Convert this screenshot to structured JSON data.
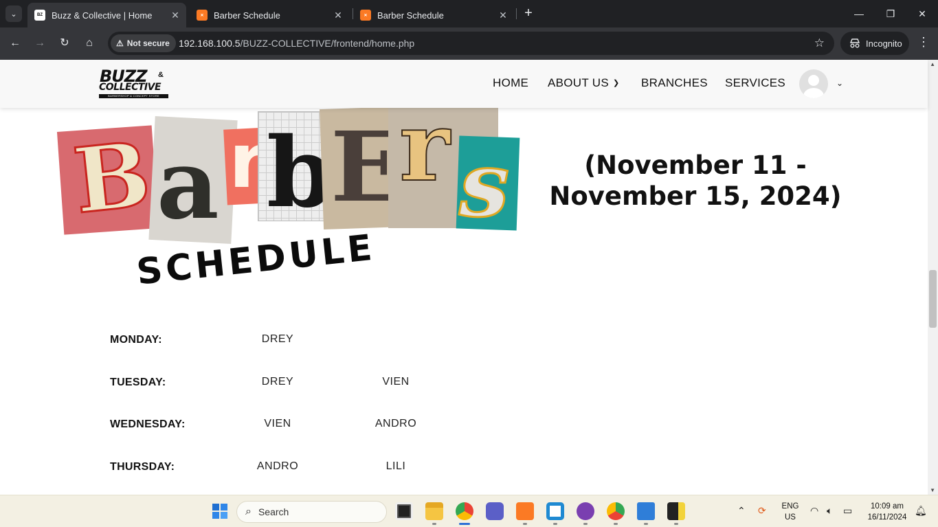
{
  "browser": {
    "tabs": [
      {
        "title": "Buzz & Collective | Home",
        "favicon": "buzz-favicon",
        "active": true
      },
      {
        "title": "Barber Schedule",
        "favicon": "xampp-favicon",
        "active": false
      },
      {
        "title": "Barber Schedule",
        "favicon": "xampp-favicon",
        "active": false
      }
    ],
    "security_label": "Not secure",
    "url_host": "192.168.100.5",
    "url_path": "/BUZZ-COLLECTIVE/frontend/home.php",
    "incognito_label": "Incognito"
  },
  "site": {
    "logo": {
      "line1": "BUZZ",
      "amp": "&",
      "line2": "COLLECTIVE",
      "tagline": "BARBERSHOP & CONCEPT STORE"
    },
    "nav": {
      "home": "HOME",
      "about": "ABOUT US",
      "branches": "BRANCHES",
      "services": "SERVICES"
    }
  },
  "hero": {
    "title_letters": [
      "B",
      "a",
      "r",
      "b",
      "E",
      "r",
      "s"
    ],
    "subtitle": "SCHEDULE",
    "date_range_line1": "(November 11 -",
    "date_range_line2": "November 15, 2024)"
  },
  "schedule": [
    {
      "day": "MONDAY:",
      "barbers": [
        "DREY"
      ]
    },
    {
      "day": "TUESDAY:",
      "barbers": [
        "DREY",
        "VIEN"
      ]
    },
    {
      "day": "WEDNESDAY:",
      "barbers": [
        "VIEN",
        "ANDRO"
      ]
    },
    {
      "day": "THURSDAY:",
      "barbers": [
        "ANDRO",
        "LILI"
      ]
    }
  ],
  "taskbar": {
    "search_placeholder": "Search",
    "lang_line1": "ENG",
    "lang_line2": "US",
    "time": "10:09 am",
    "date": "16/11/2024"
  },
  "colors": {
    "chrome_dark": "#202124",
    "chrome_toolbar": "#35363a",
    "taskbar_bg": "#f3f0e3"
  }
}
